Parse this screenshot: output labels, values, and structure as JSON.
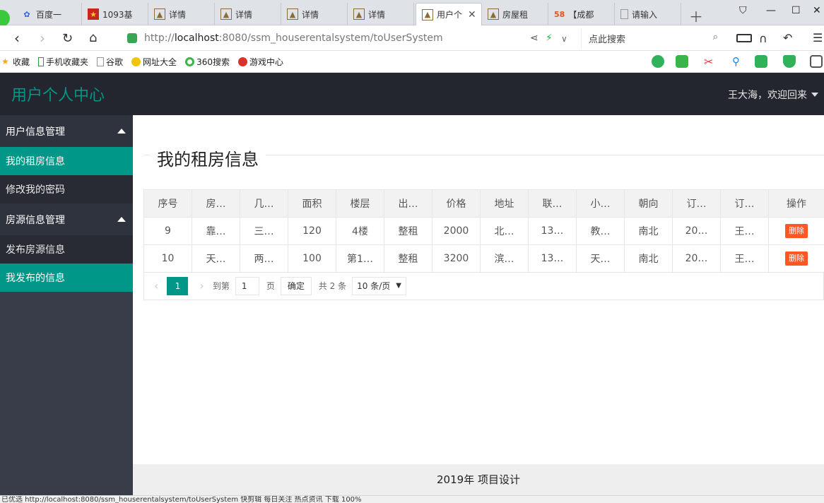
{
  "browser": {
    "tabs": [
      {
        "label": "百度一",
        "icon": "paw-icon"
      },
      {
        "label": "1093基",
        "icon": "red-square-icon"
      },
      {
        "label": "详情",
        "icon": "picture-icon"
      },
      {
        "label": "详情",
        "icon": "picture-icon"
      },
      {
        "label": "详情",
        "icon": "picture-icon"
      },
      {
        "label": "详情",
        "icon": "picture-icon"
      },
      {
        "label": "用户个",
        "icon": "picture-icon",
        "active": true
      },
      {
        "label": "房屋租",
        "icon": "picture-icon"
      },
      {
        "label": "【成都",
        "icon": "58-icon",
        "prefix": "58"
      },
      {
        "label": "请输入",
        "icon": "page-icon"
      }
    ],
    "url_prefix": "http://",
    "url_host": "localhost",
    "url_rest": ":8080/ssm_houserentalsystem/toUserSystem",
    "search_placeholder": "点此搜索",
    "bookmarks": [
      "收藏",
      "手机收藏夹",
      "谷歌",
      "网址大全",
      "360搜索",
      "游戏中心"
    ],
    "status_text": "已优选  http://localhost:8080/ssm_houserentalsystem/toUserSystem    快剪辑  每日关注  热点资讯  下载  100%"
  },
  "app": {
    "title": "用户个人中心",
    "user_greeting": "王大海，欢迎回来",
    "accent": "#009688"
  },
  "sidebar": {
    "groups": [
      {
        "label": "用户信息管理",
        "items": [
          "我的租房信息",
          "修改我的密码"
        ]
      },
      {
        "label": "房源信息管理",
        "items": [
          "发布房源信息",
          "我发布的信息"
        ]
      }
    ]
  },
  "main": {
    "title": "我的租房信息",
    "table": {
      "headers": [
        "序号",
        "房…",
        "几…",
        "面积",
        "楼层",
        "出…",
        "价格",
        "地址",
        "联…",
        "小…",
        "朝向",
        "订…",
        "订…",
        "操作"
      ],
      "rows": [
        [
          "9",
          "靠…",
          "三…",
          "120",
          "4楼",
          "整租",
          "2000",
          "北…",
          "13…",
          "教…",
          "南北",
          "20…",
          "王…",
          "删除"
        ],
        [
          "10",
          "天…",
          "两…",
          "100",
          "第1…",
          "整租",
          "3200",
          "滨…",
          "13…",
          "天…",
          "南北",
          "20…",
          "王…",
          "删除"
        ]
      ]
    },
    "pager": {
      "current_page": "1",
      "goto_label": "到第",
      "goto_value": "1",
      "page_unit": "页",
      "confirm_label": "确定",
      "total_text": "共 2 条",
      "page_size": "10 条/页"
    }
  },
  "footer": {
    "text": "2019年 项目设计"
  }
}
